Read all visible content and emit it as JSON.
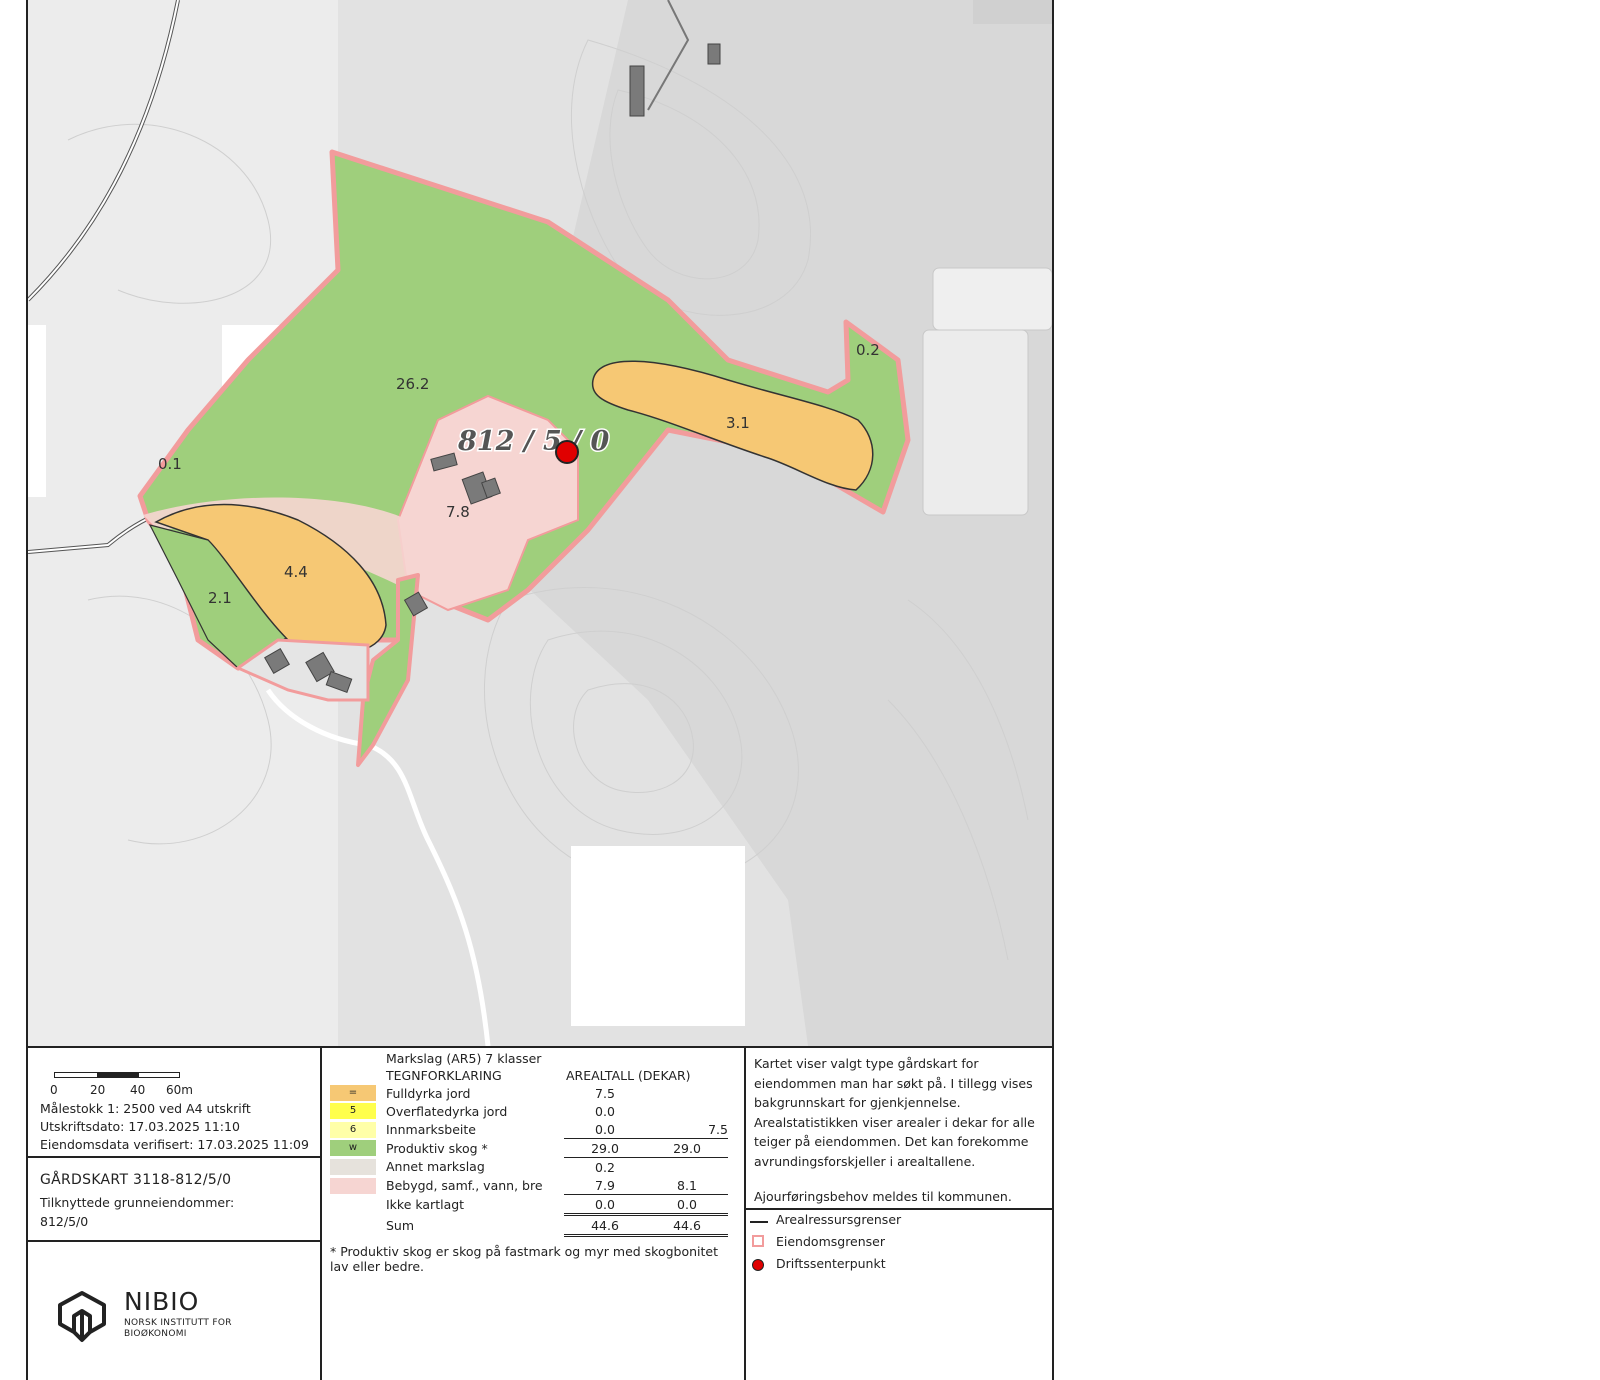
{
  "map": {
    "property_label": "812 / 5 / 0",
    "area_labels": [
      {
        "id": "forest-main",
        "text": "26.2"
      },
      {
        "id": "yard",
        "text": "7.8"
      },
      {
        "id": "east-field",
        "text": "3.1"
      },
      {
        "id": "east-forest",
        "text": "0.2"
      },
      {
        "id": "west-sliver",
        "text": "0.1"
      },
      {
        "id": "south-field",
        "text": "4.4"
      },
      {
        "id": "south-forest",
        "text": "2.1"
      }
    ],
    "colors": {
      "fulldyrka": "#f6c874",
      "overflatedyrka": "#ffff4d",
      "innmarksbeite": "#ffffa8",
      "produktiv_skog": "#9fcf7c",
      "annet": "#e6e2dc",
      "bebygd": "#f6d5d2",
      "border": "#f29c9c",
      "centre_point": "#e00000",
      "background": "#e3e3e3"
    }
  },
  "scale": {
    "ticks": [
      "0",
      "20",
      "40",
      "60m"
    ],
    "scale_text": "Målestokk 1: 2500 ved A4 utskrift",
    "print_date": "Utskriftsdato: 17.03.2025 11:10",
    "verified": "Eiendomsdata verifisert: 17.03.2025 11:09"
  },
  "title": {
    "main": "GÅRDSKART  3118-812/5/0",
    "sub_label": "Tilknyttede grunneiendommer:",
    "sub_value": "812/5/0"
  },
  "logo": {
    "name": "NIBIO",
    "line1": "NORSK INSTITUTT FOR",
    "line2": "BIOØKONOMI"
  },
  "legend": {
    "heading1": "Markslag (AR5) 7 klasser",
    "heading2": "TEGNFORKLARING",
    "heading3": "AREALTALL (DEKAR)",
    "rows": [
      {
        "code": "=",
        "label": "Fulldyrka jord",
        "v1": "7.5",
        "v2": "",
        "color": "#f6c874"
      },
      {
        "code": "5",
        "label": "Overflatedyrka jord",
        "v1": "0.0",
        "v2": "",
        "color": "#ffff4d"
      },
      {
        "code": "6",
        "label": "Innmarksbeite",
        "v1": "0.0",
        "v2": "7.5",
        "color": "#ffffa8"
      },
      {
        "code": "w",
        "label": "Produktiv skog *",
        "v1": "29.0",
        "v2": "29.0",
        "color": "#9fcf7c"
      },
      {
        "code": "",
        "label": "Annet markslag",
        "v1": "0.2",
        "v2": "",
        "color": "#e6e2dc"
      },
      {
        "code": "",
        "label": "Bebygd, samf., vann, bre",
        "v1": "7.9",
        "v2": "8.1",
        "color": "#f6d5d2"
      },
      {
        "code": "",
        "label": "Ikke kartlagt",
        "v1": "0.0",
        "v2": "0.0",
        "color": ""
      },
      {
        "code": "",
        "label": "Sum",
        "v1": "44.6",
        "v2": "44.6",
        "color": ""
      }
    ],
    "footnote": "* Produktiv skog er skog på fastmark og myr med skogbonitet lav eller bedre."
  },
  "info": {
    "paragraph": "Kartet viser valgt type gårdskart for eiendommen man har søkt på. I tillegg vises bakgrunnskart for gjenkjennelse. Arealstatistikken viser arealer i dekar for alle teiger på eiendommen. Det kan forekomme avrundingsforskjeller i arealtallene.",
    "report": "Ajourføringsbehov meldes til kommunen.",
    "symbols": [
      "Arealressursgrenser",
      "Eiendomsgrenser",
      "Driftssenterpunkt"
    ]
  }
}
